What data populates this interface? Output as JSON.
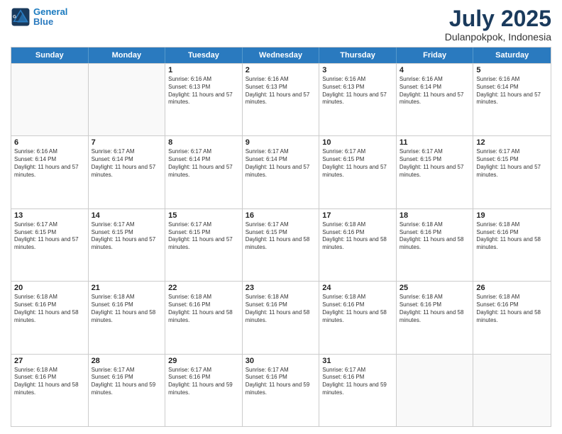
{
  "header": {
    "logo_line1": "General",
    "logo_line2": "Blue",
    "month_year": "July 2025",
    "location": "Dulanpokpok, Indonesia"
  },
  "days_of_week": [
    "Sunday",
    "Monday",
    "Tuesday",
    "Wednesday",
    "Thursday",
    "Friday",
    "Saturday"
  ],
  "weeks": [
    [
      {
        "day": "",
        "info": ""
      },
      {
        "day": "",
        "info": ""
      },
      {
        "day": "1",
        "info": "Sunrise: 6:16 AM\nSunset: 6:13 PM\nDaylight: 11 hours and 57 minutes."
      },
      {
        "day": "2",
        "info": "Sunrise: 6:16 AM\nSunset: 6:13 PM\nDaylight: 11 hours and 57 minutes."
      },
      {
        "day": "3",
        "info": "Sunrise: 6:16 AM\nSunset: 6:13 PM\nDaylight: 11 hours and 57 minutes."
      },
      {
        "day": "4",
        "info": "Sunrise: 6:16 AM\nSunset: 6:14 PM\nDaylight: 11 hours and 57 minutes."
      },
      {
        "day": "5",
        "info": "Sunrise: 6:16 AM\nSunset: 6:14 PM\nDaylight: 11 hours and 57 minutes."
      }
    ],
    [
      {
        "day": "6",
        "info": "Sunrise: 6:16 AM\nSunset: 6:14 PM\nDaylight: 11 hours and 57 minutes."
      },
      {
        "day": "7",
        "info": "Sunrise: 6:17 AM\nSunset: 6:14 PM\nDaylight: 11 hours and 57 minutes."
      },
      {
        "day": "8",
        "info": "Sunrise: 6:17 AM\nSunset: 6:14 PM\nDaylight: 11 hours and 57 minutes."
      },
      {
        "day": "9",
        "info": "Sunrise: 6:17 AM\nSunset: 6:14 PM\nDaylight: 11 hours and 57 minutes."
      },
      {
        "day": "10",
        "info": "Sunrise: 6:17 AM\nSunset: 6:15 PM\nDaylight: 11 hours and 57 minutes."
      },
      {
        "day": "11",
        "info": "Sunrise: 6:17 AM\nSunset: 6:15 PM\nDaylight: 11 hours and 57 minutes."
      },
      {
        "day": "12",
        "info": "Sunrise: 6:17 AM\nSunset: 6:15 PM\nDaylight: 11 hours and 57 minutes."
      }
    ],
    [
      {
        "day": "13",
        "info": "Sunrise: 6:17 AM\nSunset: 6:15 PM\nDaylight: 11 hours and 57 minutes."
      },
      {
        "day": "14",
        "info": "Sunrise: 6:17 AM\nSunset: 6:15 PM\nDaylight: 11 hours and 57 minutes."
      },
      {
        "day": "15",
        "info": "Sunrise: 6:17 AM\nSunset: 6:15 PM\nDaylight: 11 hours and 57 minutes."
      },
      {
        "day": "16",
        "info": "Sunrise: 6:17 AM\nSunset: 6:15 PM\nDaylight: 11 hours and 58 minutes."
      },
      {
        "day": "17",
        "info": "Sunrise: 6:18 AM\nSunset: 6:16 PM\nDaylight: 11 hours and 58 minutes."
      },
      {
        "day": "18",
        "info": "Sunrise: 6:18 AM\nSunset: 6:16 PM\nDaylight: 11 hours and 58 minutes."
      },
      {
        "day": "19",
        "info": "Sunrise: 6:18 AM\nSunset: 6:16 PM\nDaylight: 11 hours and 58 minutes."
      }
    ],
    [
      {
        "day": "20",
        "info": "Sunrise: 6:18 AM\nSunset: 6:16 PM\nDaylight: 11 hours and 58 minutes."
      },
      {
        "day": "21",
        "info": "Sunrise: 6:18 AM\nSunset: 6:16 PM\nDaylight: 11 hours and 58 minutes."
      },
      {
        "day": "22",
        "info": "Sunrise: 6:18 AM\nSunset: 6:16 PM\nDaylight: 11 hours and 58 minutes."
      },
      {
        "day": "23",
        "info": "Sunrise: 6:18 AM\nSunset: 6:16 PM\nDaylight: 11 hours and 58 minutes."
      },
      {
        "day": "24",
        "info": "Sunrise: 6:18 AM\nSunset: 6:16 PM\nDaylight: 11 hours and 58 minutes."
      },
      {
        "day": "25",
        "info": "Sunrise: 6:18 AM\nSunset: 6:16 PM\nDaylight: 11 hours and 58 minutes."
      },
      {
        "day": "26",
        "info": "Sunrise: 6:18 AM\nSunset: 6:16 PM\nDaylight: 11 hours and 58 minutes."
      }
    ],
    [
      {
        "day": "27",
        "info": "Sunrise: 6:18 AM\nSunset: 6:16 PM\nDaylight: 11 hours and 58 minutes."
      },
      {
        "day": "28",
        "info": "Sunrise: 6:17 AM\nSunset: 6:16 PM\nDaylight: 11 hours and 59 minutes."
      },
      {
        "day": "29",
        "info": "Sunrise: 6:17 AM\nSunset: 6:16 PM\nDaylight: 11 hours and 59 minutes."
      },
      {
        "day": "30",
        "info": "Sunrise: 6:17 AM\nSunset: 6:16 PM\nDaylight: 11 hours and 59 minutes."
      },
      {
        "day": "31",
        "info": "Sunrise: 6:17 AM\nSunset: 6:16 PM\nDaylight: 11 hours and 59 minutes."
      },
      {
        "day": "",
        "info": ""
      },
      {
        "day": "",
        "info": ""
      }
    ]
  ]
}
